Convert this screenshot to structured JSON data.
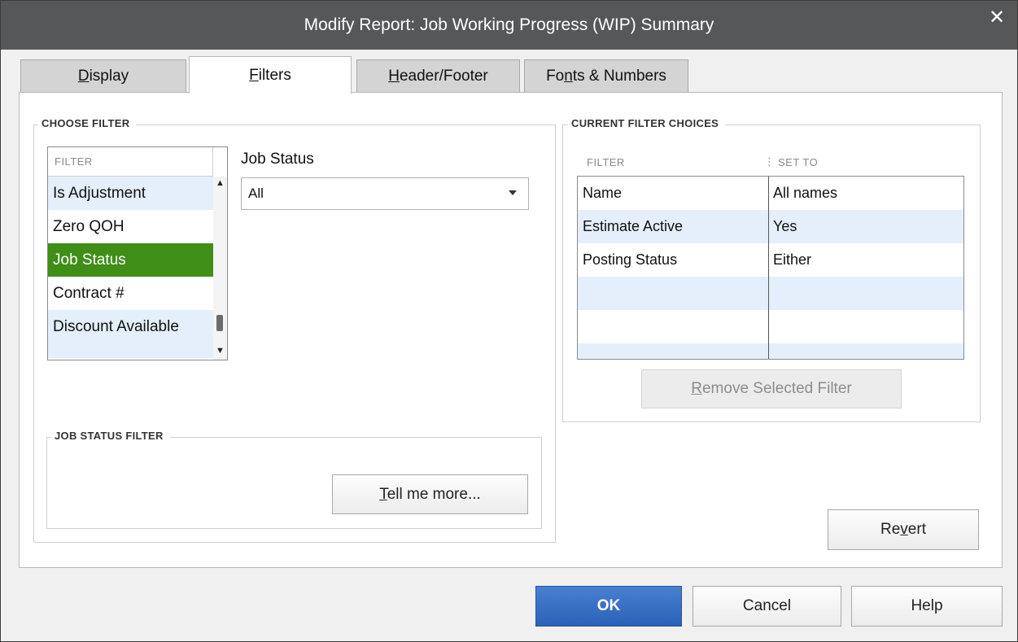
{
  "window": {
    "title": "Modify Report: Job Working Progress (WIP) Summary",
    "close_glyph": "✕"
  },
  "tabs": [
    {
      "label": "Display",
      "underline": "D",
      "rest": "isplay",
      "active": false
    },
    {
      "label": "Filters",
      "underline": "F",
      "rest": "ilters",
      "active": true
    },
    {
      "label": "Header/Footer",
      "underline": "H",
      "rest": "eader/Footer",
      "active": false
    },
    {
      "label": "Fonts & Numbers",
      "pre": "Fo",
      "underline": "n",
      "rest": "ts & Numbers",
      "active": false
    }
  ],
  "choose_filter": {
    "group_label": "CHOOSE FILTER",
    "list_header": "FILTER",
    "items": [
      "Is Adjustment",
      "Zero QOH",
      "Job Status",
      "Contract #",
      "Discount Available"
    ],
    "selected_index": 2
  },
  "job_status": {
    "label": "Job Status",
    "value": "All"
  },
  "job_status_filter": {
    "group_label": "JOB STATUS FILTER",
    "tell_me_pre": "",
    "tell_me_underline": "T",
    "tell_me_rest": "ell me more..."
  },
  "current_filters": {
    "group_label": "CURRENT FILTER CHOICES",
    "col_filter": "FILTER",
    "col_set_to": "SET TO",
    "rows": [
      {
        "filter": "Name",
        "set_to": "All names"
      },
      {
        "filter": "Estimate Active",
        "set_to": "Yes"
      },
      {
        "filter": "Posting Status",
        "set_to": "Either"
      }
    ],
    "remove_underline": "R",
    "remove_rest": "emove Selected Filter"
  },
  "revert": {
    "pre": "Re",
    "underline": "v",
    "rest": "ert"
  },
  "footer": {
    "ok": "OK",
    "cancel": "Cancel",
    "help": "Help"
  },
  "colors": {
    "selected_row": "#3e8e17",
    "alt_row": "#e4effb",
    "primary_button": "#2b61b8",
    "titlebar": "#555759"
  }
}
